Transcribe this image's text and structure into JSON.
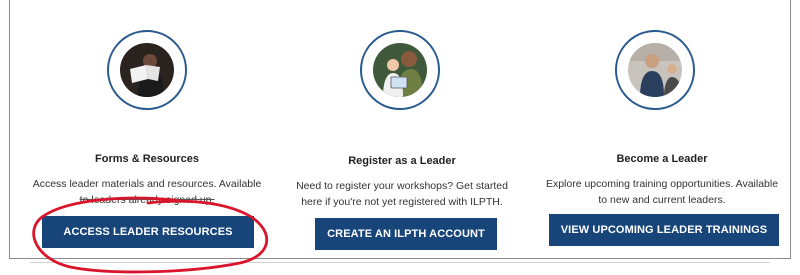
{
  "cards": [
    {
      "title": "Forms & Resources",
      "desc_line1": "Access leader materials and resources. Available",
      "desc_line2": "to leaders already signed up.",
      "button": "ACCESS LEADER RESOURCES",
      "photo_icon": "reading-woman-photo"
    },
    {
      "title": "Register as a Leader",
      "desc_line1": "Need to register your workshops? Get started",
      "desc_line2": "here if you're not yet registered with ILPTH.",
      "button": "CREATE AN ILPTH ACCOUNT",
      "photo_icon": "grandparent-child-tablet-photo"
    },
    {
      "title": "Become a Leader",
      "desc_line1": "Explore upcoming training opportunities. Available",
      "desc_line2": "to new and current leaders.",
      "button": "VIEW UPCOMING LEADER TRAININGS",
      "photo_icon": "trainer-presenting-photo"
    }
  ],
  "colors": {
    "button_bg": "#17457a",
    "ring": "#2a5a8e",
    "annotation": "#d9142b"
  }
}
